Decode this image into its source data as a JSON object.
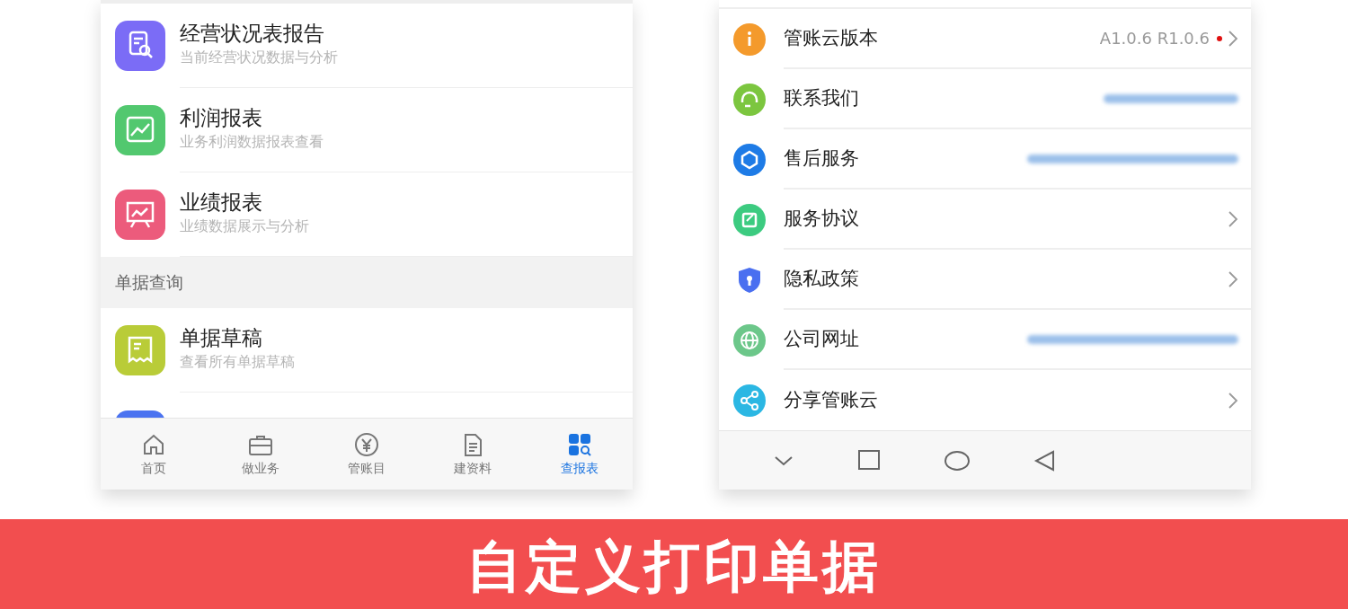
{
  "report_screen": {
    "items": [
      {
        "title": "经营状况表报告",
        "subtitle": "当前经营状况数据与分析",
        "color": "#7b6cf6"
      },
      {
        "title": "利润报表",
        "subtitle": "业务利润数据报表查看",
        "color": "#52c86f"
      },
      {
        "title": "业绩报表",
        "subtitle": "业绩数据展示与分析",
        "color": "#ec5b7c"
      }
    ],
    "section": {
      "title": "单据查询",
      "items": [
        {
          "title": "单据草稿",
          "subtitle": "查看所有单据草稿",
          "color": "#b9cc38"
        },
        {
          "color": "#4b73f0"
        }
      ]
    },
    "tab_bar": [
      {
        "label": "首页",
        "selected": false
      },
      {
        "label": "做业务",
        "selected": false
      },
      {
        "label": "管账目",
        "selected": false
      },
      {
        "label": "建资料",
        "selected": false
      },
      {
        "label": "查报表",
        "selected": true
      }
    ]
  },
  "settings_screen": {
    "rows": [
      {
        "label": "管账云版本",
        "value": "A1.0.6 R1.0.6",
        "badge": true,
        "chevron": true,
        "blurred": false,
        "color": "#f49a2c"
      },
      {
        "label": "联系我们",
        "badge": false,
        "chevron": false,
        "blurred": true,
        "color": "#7cc63f"
      },
      {
        "label": "售后服务",
        "badge": false,
        "chevron": false,
        "blurred": true,
        "color": "#1e7be6"
      },
      {
        "label": "服务协议",
        "badge": false,
        "chevron": true,
        "blurred": false,
        "color": "#3ccb80"
      },
      {
        "label": "隐私政策",
        "badge": false,
        "chevron": true,
        "blurred": false,
        "color": "#4a6ff0"
      },
      {
        "label": "公司网址",
        "badge": false,
        "chevron": false,
        "blurred": true,
        "color": "#6cc78a"
      },
      {
        "label": "分享管账云",
        "badge": false,
        "chevron": true,
        "blurred": false,
        "color": "#2bb7e3"
      }
    ]
  },
  "banner": {
    "title": "自定义打印单据"
  }
}
